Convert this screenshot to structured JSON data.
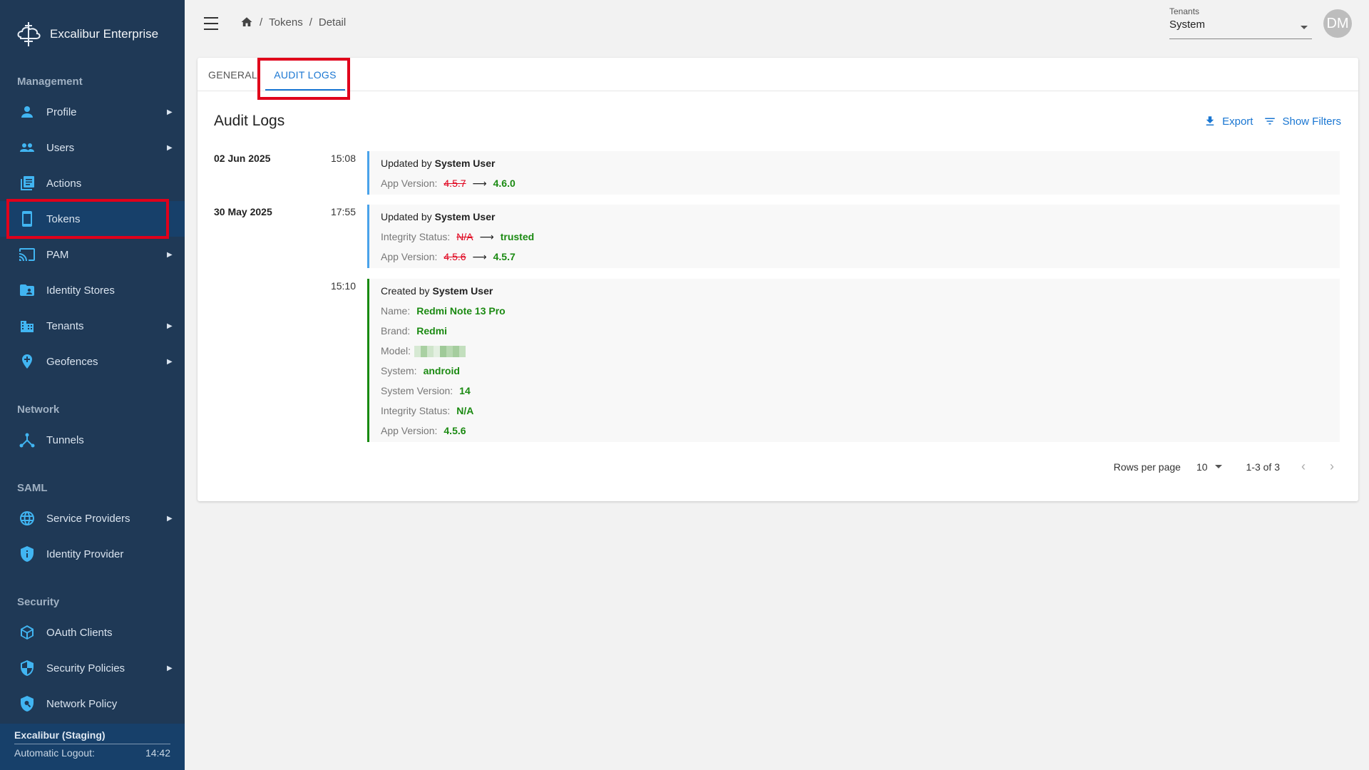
{
  "app": {
    "name": "Excalibur Enterprise"
  },
  "sidebar": {
    "sections": [
      {
        "title": "Management"
      },
      {
        "title": "Network"
      },
      {
        "title": "SAML"
      },
      {
        "title": "Security"
      }
    ],
    "items": [
      {
        "label": "Profile",
        "icon": "person-icon"
      },
      {
        "label": "Users",
        "icon": "users-icon"
      },
      {
        "label": "Actions",
        "icon": "actions-icon"
      },
      {
        "label": "Tokens",
        "icon": "phone-icon"
      },
      {
        "label": "PAM",
        "icon": "cast-icon"
      },
      {
        "label": "Identity Stores",
        "icon": "folder-account-icon"
      },
      {
        "label": "Tenants",
        "icon": "building-icon"
      },
      {
        "label": "Geofences",
        "icon": "location-add-icon"
      },
      {
        "label": "Tunnels",
        "icon": "tunnel-icon"
      },
      {
        "label": "Service Providers",
        "icon": "globe-icon"
      },
      {
        "label": "Identity Provider",
        "icon": "shield-info-icon"
      },
      {
        "label": "OAuth Clients",
        "icon": "cube-icon"
      },
      {
        "label": "Security Policies",
        "icon": "shield-policy-icon"
      },
      {
        "label": "Network Policy",
        "icon": "shield-search-icon"
      }
    ],
    "footer": {
      "environment": "Excalibur (Staging)",
      "logout_label": "Automatic Logout:",
      "logout_time": "14:42"
    }
  },
  "header": {
    "breadcrumb": [
      "Tokens",
      "Detail"
    ],
    "tenant_label": "Tenants",
    "tenant_value": "System",
    "avatar_initials": "DM"
  },
  "tabs": {
    "general": "GENERAL",
    "audit_logs": "AUDIT LOGS"
  },
  "audit": {
    "title": "Audit Logs",
    "export_label": "Export",
    "filters_label": "Show Filters",
    "entries": [
      {
        "date": "02 Jun 2025",
        "time": "15:08",
        "action": "Updated by",
        "user": "System User",
        "app_version_label": "App Version:",
        "app_version_old": "4.5.7",
        "app_version_new": "4.6.0"
      },
      {
        "date": "30 May 2025",
        "time": "17:55",
        "action": "Updated by",
        "user": "System User",
        "integrity_label": "Integrity Status:",
        "integrity_old": "N/A",
        "integrity_new": "trusted",
        "app_version_label": "App Version:",
        "app_version_old": "4.5.6",
        "app_version_new": "4.5.7"
      },
      {
        "date": "",
        "time": "15:10",
        "action": "Created by",
        "user": "System User",
        "name_label": "Name:",
        "name": "Redmi Note 13 Pro",
        "brand_label": "Brand:",
        "brand": "Redmi",
        "model_label": "Model:",
        "system_label": "System:",
        "system": "android",
        "system_version_label": "System Version:",
        "system_version": "14",
        "integrity_label": "Integrity Status:",
        "integrity": "N/A",
        "app_version_label": "App Version:",
        "app_version": "4.5.6"
      }
    ],
    "pagination": {
      "rows_per_page_label": "Rows per page",
      "rows_per_page": "10",
      "range": "1-3 of 3"
    }
  },
  "colors": {
    "sidebar_bg": "#1f3956",
    "accent": "#1976d2",
    "highlight": "#e0001b",
    "added": "#1b8a12",
    "removed": "#e0001b"
  }
}
